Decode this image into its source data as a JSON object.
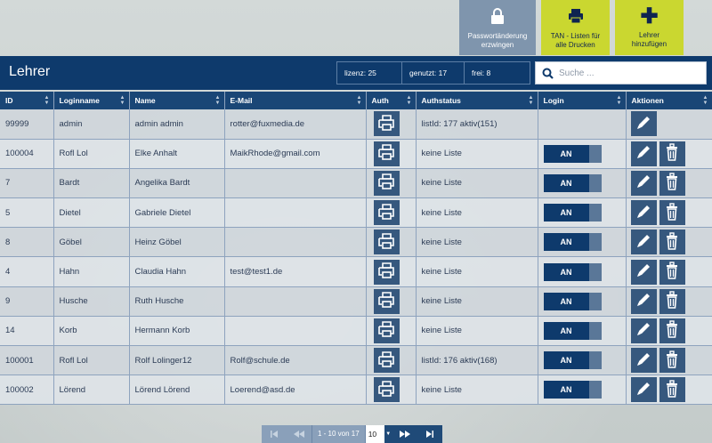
{
  "top_actions": {
    "force_password": {
      "line1": "Passwortänderung",
      "line2": "erzwingen"
    },
    "tan_print": {
      "line1": "TAN - Listen für",
      "line2": "alle Drucken"
    },
    "add_teacher": {
      "symbol": "✚",
      "line1": "Lehrer",
      "line2": "hinzufügen"
    }
  },
  "header": {
    "title": "Lehrer",
    "stats": {
      "license": "lizenz: 25",
      "used": "genutzt: 17",
      "free": "frei: 8"
    },
    "search_placeholder": "Suche ..."
  },
  "table": {
    "columns": [
      "ID",
      "Loginname",
      "Name",
      "E-Mail",
      "Auth",
      "Authstatus",
      "Login",
      "Aktionen"
    ],
    "toggle_label": "AN",
    "rows": [
      {
        "id": "99999",
        "login": "admin",
        "name": "admin admin",
        "email": "rotter@fuxmedia.de",
        "authstatus": "listId: 177 aktiv(151)",
        "has_toggle": false,
        "can_delete": false
      },
      {
        "id": "100004",
        "login": "Rofl Lol",
        "name": "Elke Anhalt",
        "email": "MaikRhode@gmail.com",
        "authstatus": "keine Liste",
        "has_toggle": true,
        "can_delete": true
      },
      {
        "id": "7",
        "login": "Bardt",
        "name": "Angelika Bardt",
        "email": "",
        "authstatus": "keine Liste",
        "has_toggle": true,
        "can_delete": true
      },
      {
        "id": "5",
        "login": "Dietel",
        "name": "Gabriele Dietel",
        "email": "",
        "authstatus": "keine Liste",
        "has_toggle": true,
        "can_delete": true
      },
      {
        "id": "8",
        "login": "Göbel",
        "name": "Heinz Göbel",
        "email": "",
        "authstatus": "keine Liste",
        "has_toggle": true,
        "can_delete": true
      },
      {
        "id": "4",
        "login": "Hahn",
        "name": "Claudia Hahn",
        "email": "test@test1.de",
        "authstatus": "keine Liste",
        "has_toggle": true,
        "can_delete": true
      },
      {
        "id": "9",
        "login": "Husche",
        "name": "Ruth Husche",
        "email": "",
        "authstatus": "keine Liste",
        "has_toggle": true,
        "can_delete": true
      },
      {
        "id": "14",
        "login": "Korb",
        "name": "Hermann Korb",
        "email": "",
        "authstatus": "keine Liste",
        "has_toggle": true,
        "can_delete": true
      },
      {
        "id": "100001",
        "login": "Rofl Lol",
        "name": "Rolf Lolinger12",
        "email": "Rolf@schule.de",
        "authstatus": "listId: 176 aktiv(168)",
        "has_toggle": true,
        "can_delete": true
      },
      {
        "id": "100002",
        "login": "Lörend",
        "name": "Lörend Lörend",
        "email": "Loerend@asd.de",
        "authstatus": "keine Liste",
        "has_toggle": true,
        "can_delete": true
      }
    ]
  },
  "pagination": {
    "info": "1 - 10 von 17",
    "page_size": "10"
  },
  "icons": {
    "lock": "lock-icon",
    "printer": "printer-icon",
    "plus": "plus-icon",
    "search": "search-icon",
    "edit": "pencil-icon",
    "delete": "trash-icon"
  },
  "colors": {
    "header_navy": "#0e3a6c",
    "accent_lime": "#cad730",
    "button_blue": "#36587e",
    "muted_blue": "#7f95ad"
  }
}
